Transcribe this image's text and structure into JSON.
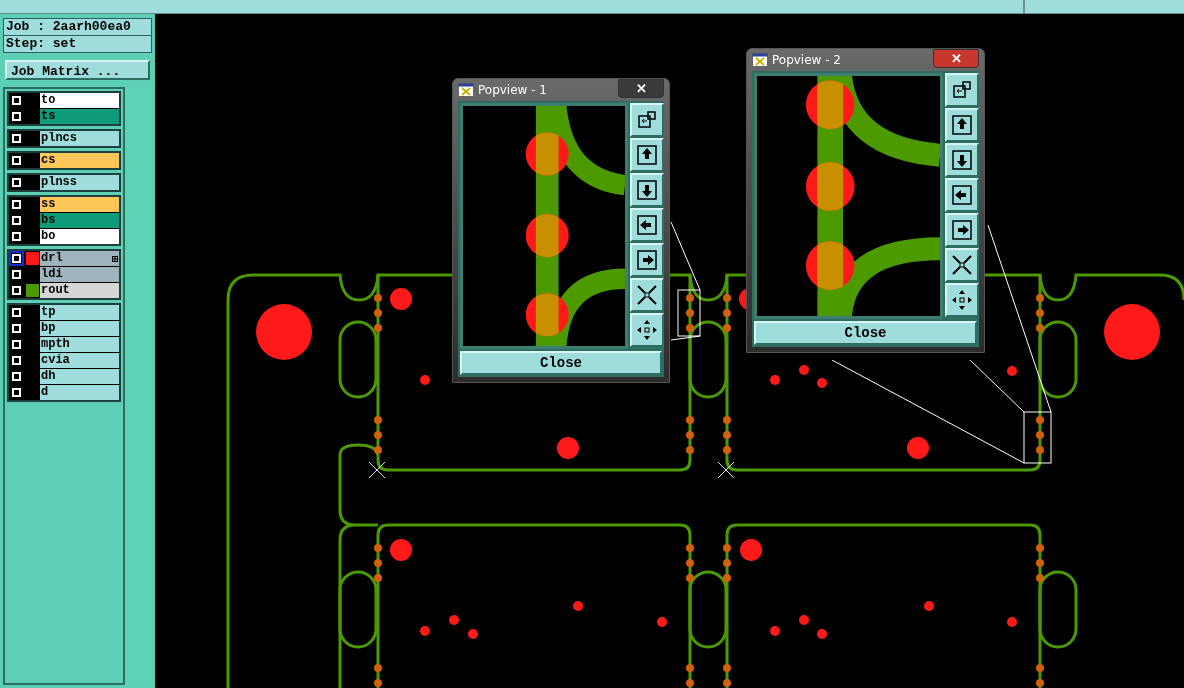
{
  "header": {
    "job": "Job : 2aarh00ea0",
    "step": "Step: set"
  },
  "job_matrix_button": "Job Matrix ...",
  "layer_groups": [
    [
      {
        "name": "to",
        "kind": "silk",
        "selected": false
      },
      {
        "name": "ts",
        "kind": "mask",
        "selected": false
      }
    ],
    [
      {
        "name": "plncs",
        "kind": "plain",
        "selected": false
      }
    ],
    [
      {
        "name": "cs",
        "kind": "signal",
        "selected": false
      }
    ],
    [
      {
        "name": "plnss",
        "kind": "plain",
        "selected": false
      }
    ],
    [
      {
        "name": "ss",
        "kind": "signal",
        "selected": false
      },
      {
        "name": "bs",
        "kind": "mask",
        "selected": false
      },
      {
        "name": "bo",
        "kind": "silk",
        "selected": false
      }
    ],
    [
      {
        "name": "drl",
        "kind": "drill",
        "color": "#ff1a1a",
        "selected": true
      },
      {
        "name": "ldi",
        "kind": "drill",
        "selected": false
      },
      {
        "name": "rout",
        "kind": "rout",
        "color": "#4c9a00",
        "selected": false
      }
    ],
    [
      {
        "name": "tp",
        "kind": "plain",
        "selected": false
      },
      {
        "name": "bp",
        "kind": "plain",
        "selected": false
      },
      {
        "name": "mpth",
        "kind": "plain",
        "selected": false
      },
      {
        "name": "cvia",
        "kind": "plain",
        "selected": false
      },
      {
        "name": "dh",
        "kind": "plain",
        "selected": false
      },
      {
        "name": "d",
        "kind": "plain",
        "selected": false
      }
    ]
  ],
  "popviews": [
    {
      "title": "Popview - 1",
      "close_glyph": "✕",
      "close_label": "Close",
      "active": false
    },
    {
      "title": "Popview - 2",
      "close_glyph": "✕",
      "close_label": "Close",
      "active": true
    }
  ]
}
